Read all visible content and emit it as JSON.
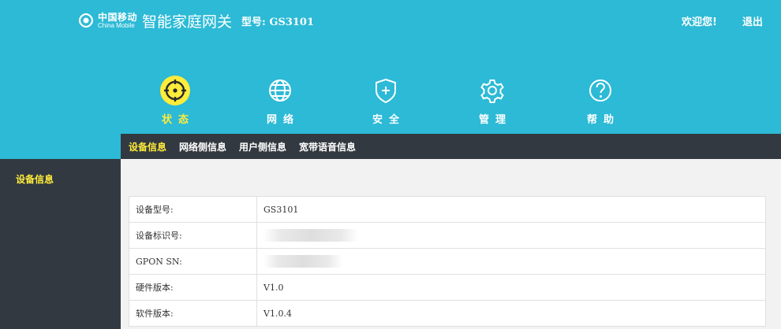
{
  "header": {
    "brand_cn": "中国移动",
    "brand_en": "China Mobile",
    "title": "智能家庭网关",
    "model": "型号: GS3101",
    "welcome": "欢迎您!",
    "logout": "退出"
  },
  "nav": [
    {
      "label": "状态",
      "icon": "target-icon",
      "active": true
    },
    {
      "label": "网络",
      "icon": "globe-icon",
      "active": false
    },
    {
      "label": "安全",
      "icon": "shield-plus-icon",
      "active": false
    },
    {
      "label": "管理",
      "icon": "gear-icon",
      "active": false
    },
    {
      "label": "帮助",
      "icon": "question-icon",
      "active": false
    }
  ],
  "subnav": [
    {
      "label": "设备信息",
      "active": true
    },
    {
      "label": "网络侧信息",
      "active": false
    },
    {
      "label": "用户侧信息",
      "active": false
    },
    {
      "label": "宽带语音信息",
      "active": false
    }
  ],
  "sidebar": {
    "items": [
      {
        "label": "设备信息"
      }
    ]
  },
  "device_info": {
    "rows": [
      {
        "label": "设备型号:",
        "value": "GS3101"
      },
      {
        "label": "设备标识号:",
        "value": ""
      },
      {
        "label": "GPON SN:",
        "value": ""
      },
      {
        "label": "硬件版本:",
        "value": "V1.0"
      },
      {
        "label": "软件版本:",
        "value": "V1.0.4"
      }
    ]
  },
  "colors": {
    "header_bg": "#2cbad6",
    "dark_bg": "#333940",
    "accent": "#ffec3b",
    "content_bg": "#f2f2f2"
  }
}
